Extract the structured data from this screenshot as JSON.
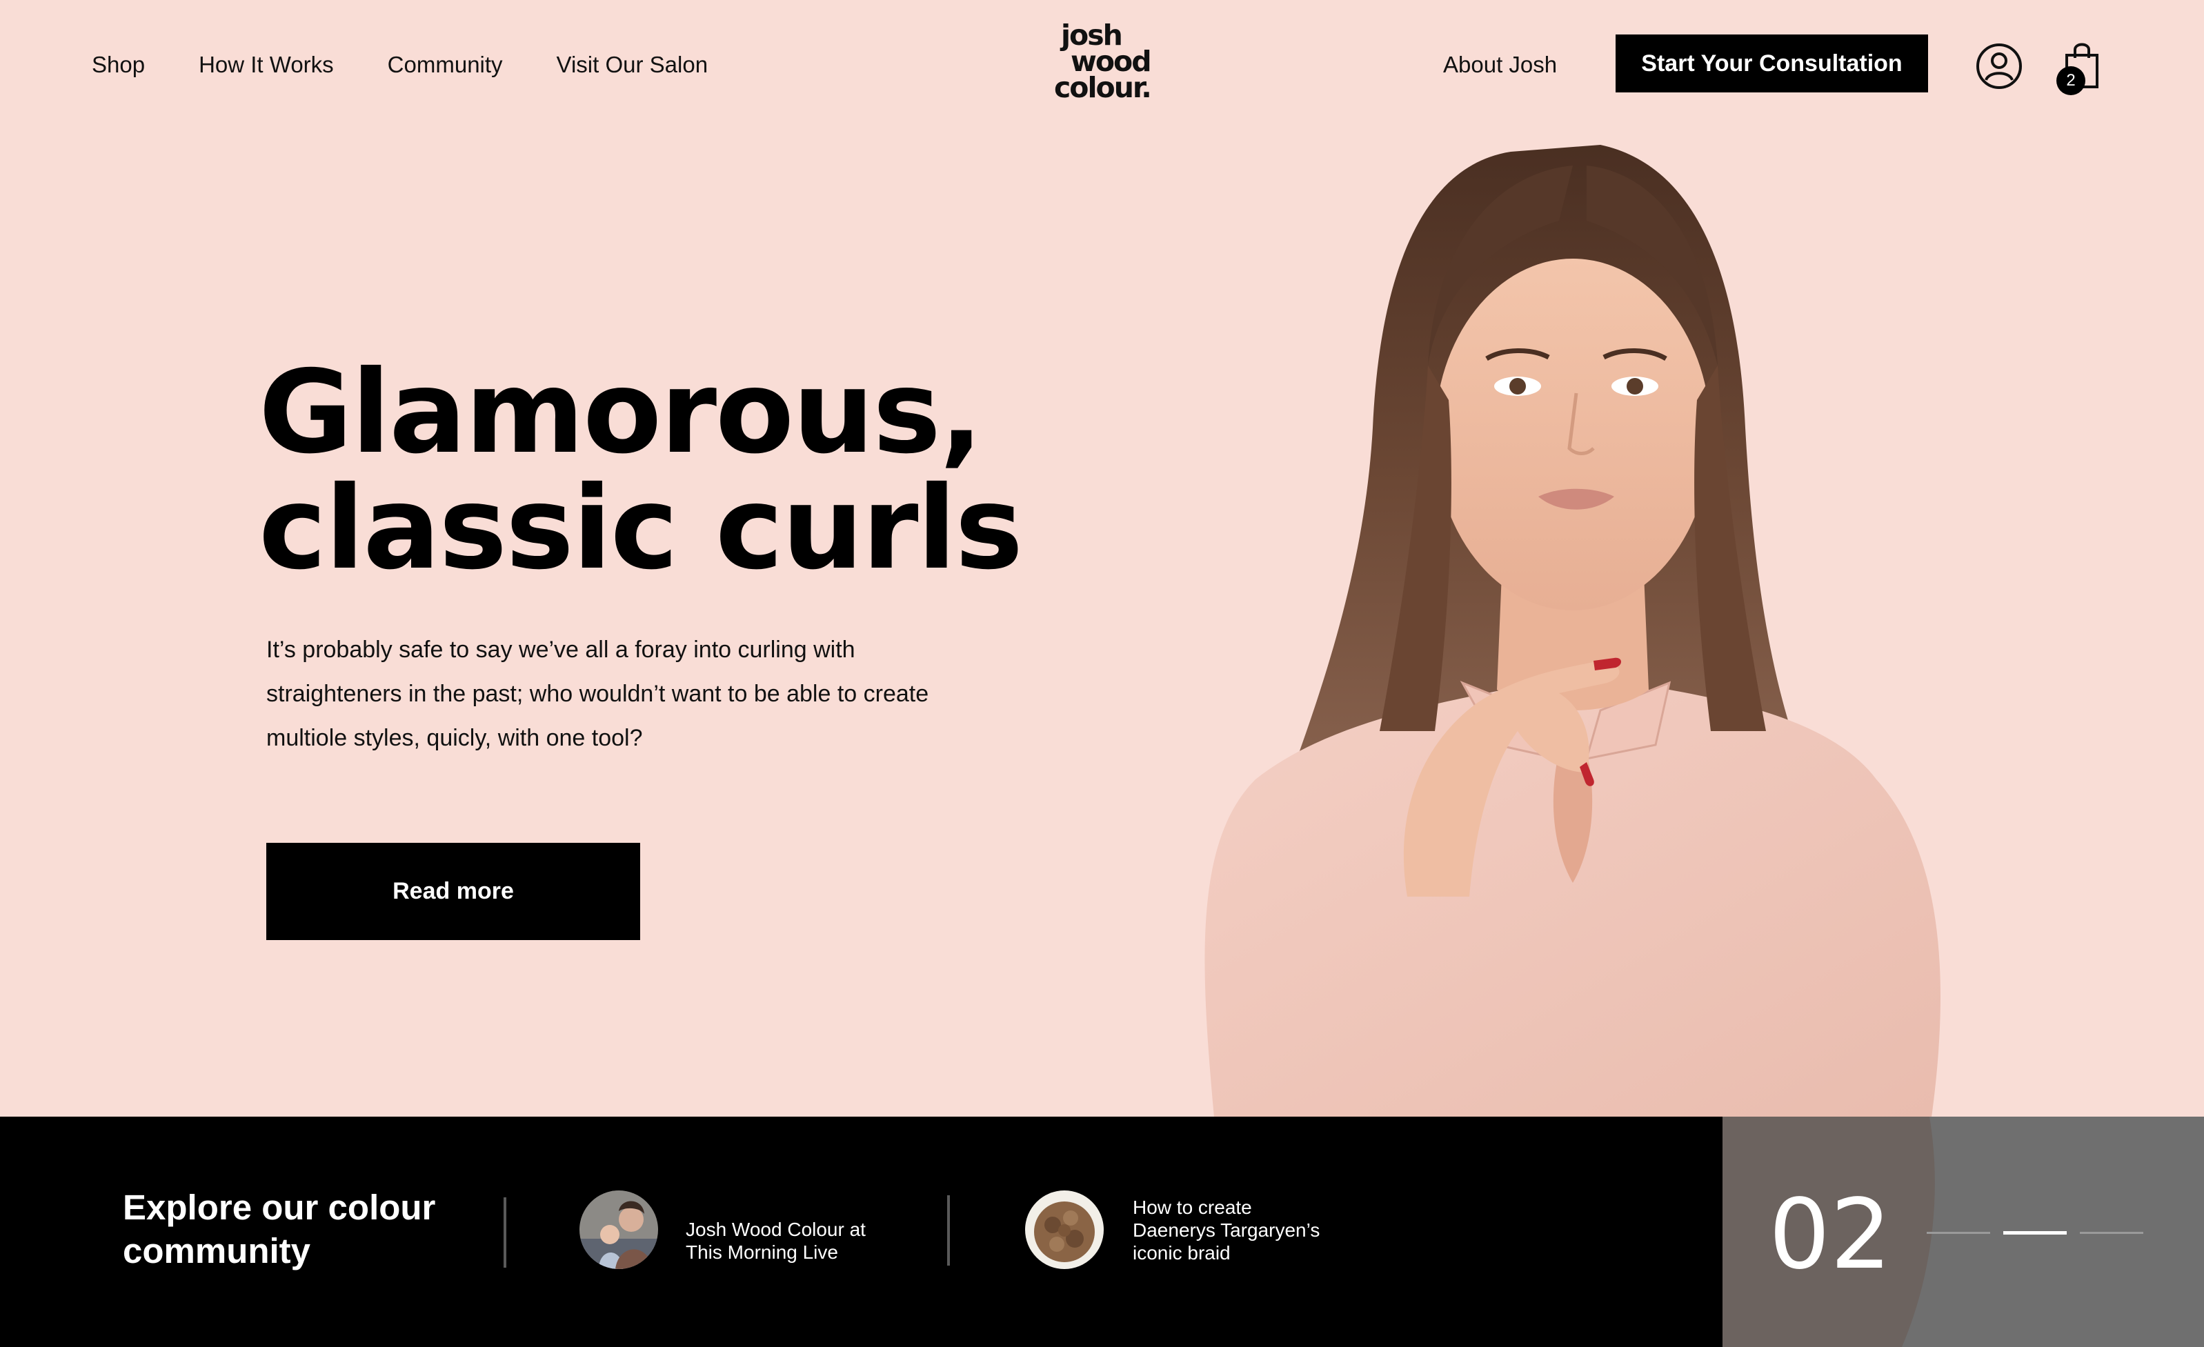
{
  "nav": {
    "links": [
      "Shop",
      "How It Works",
      "Community",
      "Visit Our Salon"
    ],
    "about": "About Josh",
    "cta": "Start Your Consultation",
    "account_icon": "user-circle-icon",
    "cart_icon": "shopping-bag-icon",
    "cart_count": "2"
  },
  "logo": {
    "line1": "josh",
    "line2": "wood",
    "line3": "colour."
  },
  "hero": {
    "title_line1": "Glamorous,",
    "title_line2": "classic curls",
    "body": "It’s probably safe to say we’ve all a foray into curling with straighteners in the past; who wouldn’t want to be able to create multiole styles, quicly, with one tool?",
    "cta": "Read more"
  },
  "community": {
    "title": "Explore our colour community",
    "stories": [
      {
        "title_line1": "Josh Wood Colour at",
        "title_line2": "This Morning Live"
      },
      {
        "title_line1": "How to create",
        "title_line2": "Daenerys Targaryen’s",
        "title_line3": "iconic braid"
      }
    ]
  },
  "slider": {
    "current": "02",
    "total_slides": 3,
    "active_index": 1
  },
  "colors": {
    "background": "#f9ddd6",
    "primary": "#000000",
    "band": "#000000",
    "slide_panel": "#6f6f6f",
    "text_on_dark": "#ffffff"
  }
}
